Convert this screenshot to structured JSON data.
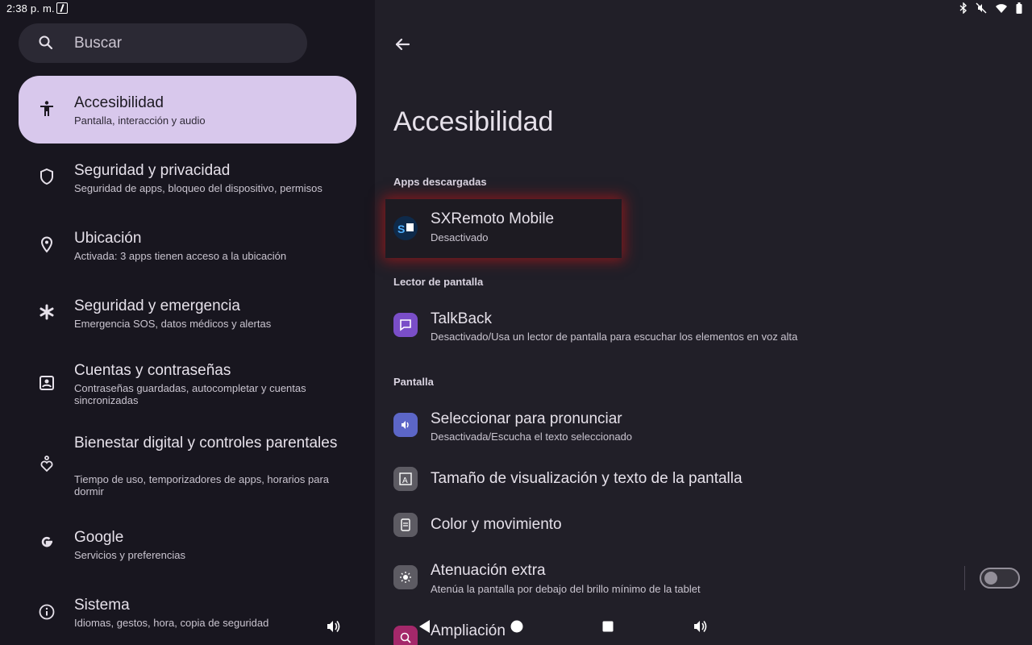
{
  "status_bar": {
    "time": "2:38 p. m.",
    "icons": [
      "app-notification-icon",
      "bluetooth-icon",
      "mute-icon",
      "wifi-icon",
      "battery-icon"
    ]
  },
  "search": {
    "placeholder": "Buscar"
  },
  "sidebar": {
    "items": [
      {
        "title": "Accesibilidad",
        "subtitle": "Pantalla, interacción y audio",
        "icon": "accessibility-icon",
        "selected": true
      },
      {
        "title": "Seguridad y privacidad",
        "subtitle": "Seguridad de apps, bloqueo del dispositivo, permisos",
        "icon": "shield-icon"
      },
      {
        "title": "Ubicación",
        "subtitle": "Activada: 3 apps tienen acceso a la ubicación",
        "icon": "location-pin-icon"
      },
      {
        "title": "Seguridad y emergencia",
        "subtitle": "Emergencia SOS, datos médicos y alertas",
        "icon": "asterisk-icon"
      },
      {
        "title": "Cuentas y contraseñas",
        "subtitle": "Contraseñas guardadas, autocompletar y cuentas sincronizadas",
        "icon": "account-box-icon"
      },
      {
        "title": "Bienestar digital y controles parentales",
        "subtitle": "Tiempo de uso, temporizadores de apps, horarios para dormir",
        "icon": "wellbeing-icon"
      },
      {
        "title": "Google",
        "subtitle": "Servicios y preferencias",
        "icon": "google-icon"
      },
      {
        "title": "Sistema",
        "subtitle": "Idiomas, gestos, hora, copia de seguridad",
        "icon": "info-icon"
      }
    ]
  },
  "main": {
    "title": "Accesibilidad",
    "sections": {
      "downloaded": "Apps descargadas",
      "screen_reader": "Lector de pantalla",
      "display": "Pantalla"
    },
    "rows": {
      "sxremoto": {
        "title": "SXRemoto Mobile",
        "subtitle": "Desactivado",
        "icon": "sxremoto-app-icon"
      },
      "talkback": {
        "title": "TalkBack",
        "subtitle": "Desactivado/Usa un lector de pantalla para escuchar los elementos en voz alta",
        "icon": "talkback-icon",
        "color": "#7a4ec8"
      },
      "select_to_speak": {
        "title": "Seleccionar para pronunciar",
        "subtitle": "Desactivada/Escucha el texto seleccionado",
        "icon": "select-to-speak-icon",
        "color": "#5c66c7"
      },
      "display_size": {
        "title": "Tamaño de visualización y texto de la pantalla",
        "icon": "text-size-icon",
        "color": "#5d5b63"
      },
      "color_motion": {
        "title": "Color y movimiento",
        "icon": "color-motion-icon",
        "color": "#5d5b63"
      },
      "extra_dim": {
        "title": "Atenuación extra",
        "subtitle": "Atenúa la pantalla por debajo del brillo mínimo de la tablet",
        "icon": "brightness-icon",
        "color": "#5d5b63",
        "toggle_on": false
      },
      "magnification": {
        "title": "Ampliación",
        "icon": "magnify-icon",
        "color": "#a4286a"
      }
    }
  },
  "nav_bar": {
    "buttons": [
      "volume-icon",
      "back-icon",
      "home-icon",
      "recents-icon",
      "volume-icon"
    ]
  },
  "colors": {
    "selected_bg": "#d8c8ec",
    "highlight_glow": "#dc1414"
  }
}
